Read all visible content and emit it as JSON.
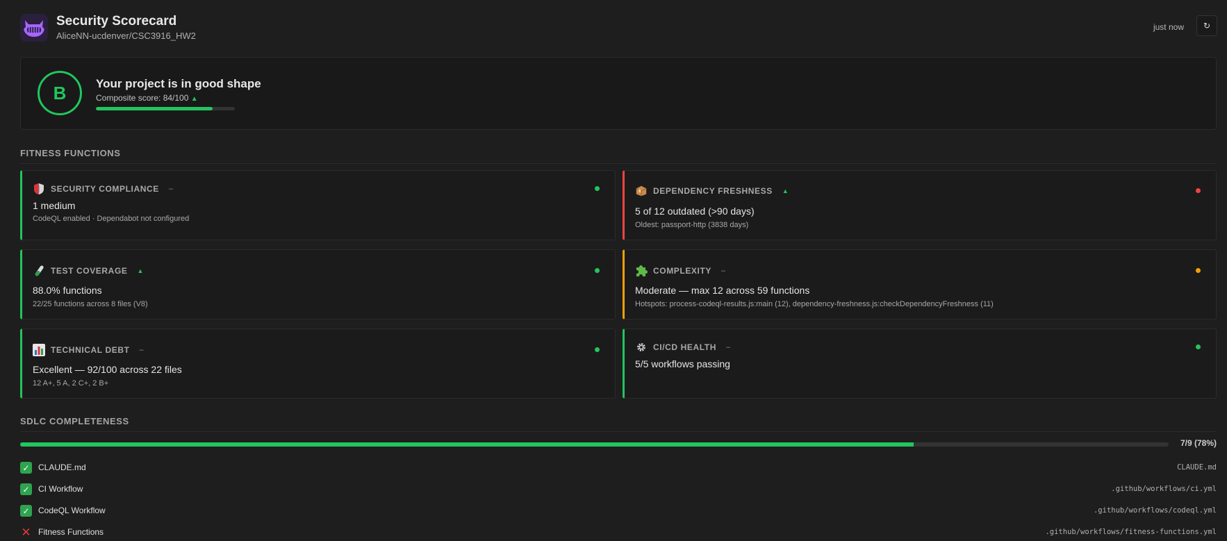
{
  "header": {
    "title": "Security Scorecard",
    "repo": "AliceNN-ucdenver/CSC3916_HW2",
    "updated": "just now",
    "refresh_icon": "↻",
    "logo_icon": "purple-octocat-face-icon"
  },
  "summary": {
    "grade": "B",
    "headline": "Your project is in good shape",
    "composite_label": "Composite score: 84/100",
    "trend_icon": "▲",
    "score": 84,
    "max_score": 100
  },
  "fitness": {
    "section_title": "FITNESS FUNCTIONS",
    "cards": [
      {
        "icon": "shield-icon",
        "name": "SECURITY COMPLIANCE",
        "trend": "–",
        "status": "green",
        "main": "1 medium",
        "detail": "CodeQL enabled · Dependabot not configured"
      },
      {
        "icon": "package-icon",
        "name": "DEPENDENCY FRESHNESS",
        "trend": "▲",
        "status": "red",
        "main": "5 of 12 outdated (>90 days)",
        "detail": "Oldest: passport-http (3838 days)"
      },
      {
        "icon": "test-tube-icon",
        "name": "TEST COVERAGE",
        "trend": "▲",
        "status": "green",
        "main": "88.0% functions",
        "detail": "22/25 functions across 8 files (V8)"
      },
      {
        "icon": "puzzle-icon",
        "name": "COMPLEXITY",
        "trend": "–",
        "status": "orange",
        "main": "Moderate — max 12 across 59 functions",
        "detail": "Hotspots: process-codeql-results.js:main (12), dependency-freshness.js:checkDependencyFreshness (11)"
      },
      {
        "icon": "bar-chart-icon",
        "name": "TECHNICAL DEBT",
        "trend": "–",
        "status": "green",
        "main": "Excellent — 92/100 across 22 files",
        "detail": "12 A+, 5 A, 2 C+, 2 B+"
      },
      {
        "icon": "gear-icon",
        "name": "CI/CD HEALTH",
        "trend": "–",
        "status": "green",
        "main": "5/5 workflows passing",
        "detail": ""
      }
    ]
  },
  "sdlc": {
    "section_title": "SDLC COMPLETENESS",
    "summary": "7/9 (78%)",
    "complete": 7,
    "total": 9,
    "items": [
      {
        "status": "done",
        "label": "CLAUDE.md",
        "path": "CLAUDE.md"
      },
      {
        "status": "done",
        "label": "CI Workflow",
        "path": ".github/workflows/ci.yml"
      },
      {
        "status": "done",
        "label": "CodeQL Workflow",
        "path": ".github/workflows/codeql.yml"
      },
      {
        "status": "missing",
        "label": "Fitness Functions",
        "path": ".github/workflows/fitness-functions.yml"
      }
    ]
  },
  "colors": {
    "accent_green": "#22c55e",
    "status_red": "#ef4444",
    "status_orange": "#f59e0b",
    "background": "#1e1e1e"
  }
}
